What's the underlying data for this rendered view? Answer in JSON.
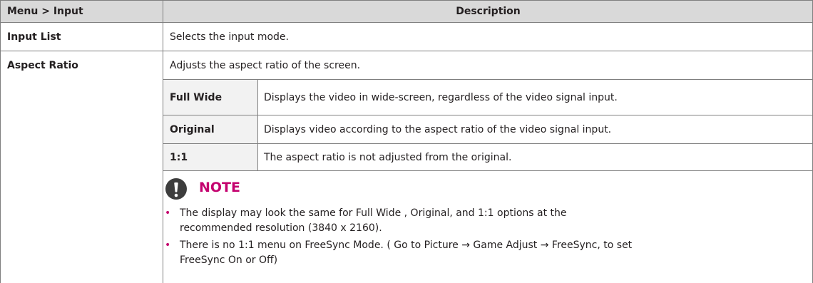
{
  "header": {
    "col1": "Menu > Input",
    "col2": "Description"
  },
  "rows": [
    {
      "name": "Input List",
      "desc": "Selects the input mode."
    },
    {
      "name": "Aspect Ratio",
      "desc": "Adjusts the aspect ratio of the screen."
    }
  ],
  "options": [
    {
      "name": "Full  Wide",
      "desc": "Displays the video in wide-screen, regardless of the video signal input."
    },
    {
      "name": "Original",
      "desc": "Displays video according to the aspect ratio of the video signal input."
    },
    {
      "name": "1:1",
      "desc": "The aspect ratio is not adjusted from the original."
    }
  ],
  "note": {
    "title": "NOTE",
    "icon": "exclamation-icon",
    "items": [
      "The display may look the same for Full Wide , Original, and 1:1 options at the recommended resolution (3840 x 2160).",
      "There is no 1:1 menu on FreeSync Mode.  ( Go to Picture → Game Adjust → FreeSync, to set FreeSync On or Off)"
    ]
  },
  "colors": {
    "header_bg": "#d9d9d9",
    "sub_bg": "#f2f2f2",
    "note_accent": "#c4006e",
    "border": "#7f7f7f"
  }
}
